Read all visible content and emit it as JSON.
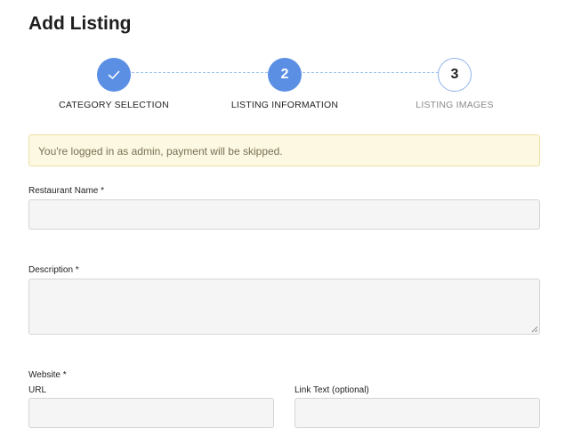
{
  "page": {
    "title": "Add Listing"
  },
  "stepper": {
    "steps": [
      {
        "number": "",
        "label": "CATEGORY SELECTION",
        "state": "completed"
      },
      {
        "number": "2",
        "label": "LISTING INFORMATION",
        "state": "active"
      },
      {
        "number": "3",
        "label": "LISTING IMAGES",
        "state": "upcoming"
      }
    ]
  },
  "notice": {
    "text": "You're logged in as admin, payment will be skipped."
  },
  "form": {
    "restaurant_name": {
      "label": "Restaurant Name *",
      "value": ""
    },
    "description": {
      "label": "Description *",
      "value": ""
    },
    "website": {
      "label": "Website *",
      "url": {
        "label": "URL",
        "value": ""
      },
      "link_text": {
        "label": "Link Text (optional)",
        "value": ""
      }
    }
  },
  "colors": {
    "accent": "#5b8fe4",
    "notice_bg": "#fcf8e1",
    "field_bg": "#f5f5f5"
  },
  "icons": {
    "completed_step": "checkmark-icon",
    "textarea_resize": "resize-grip-icon"
  }
}
